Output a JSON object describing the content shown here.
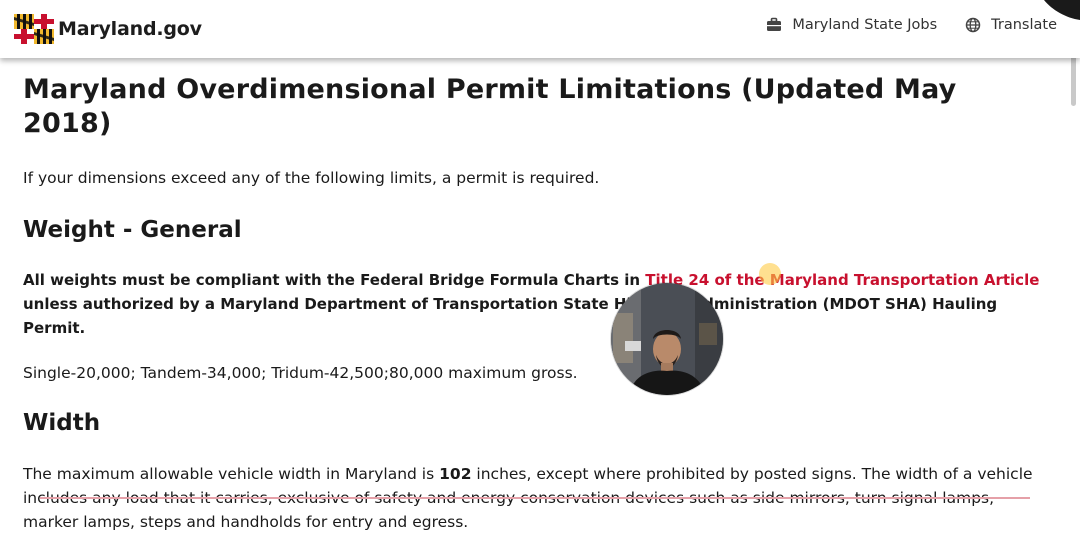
{
  "header": {
    "brand": "Maryland.gov",
    "nav": [
      {
        "label": "Maryland State Jobs",
        "icon": "briefcase-icon"
      },
      {
        "label": "Translate",
        "icon": "globe-icon"
      }
    ]
  },
  "page": {
    "title": "Maryland Overdimensional Permit Limitations (Updated May 2018)",
    "intro": "If your dimensions exceed any of the following limits, a permit is required.",
    "sections": {
      "weight": {
        "heading": "Weight - General",
        "rule_before": "All weights must be compliant with the Federal Bridge Formula Charts in ",
        "rule_link": "Title 24 of the Maryland Transportation Article",
        "rule_after": " unless authorized by a Maryland Department of Transportation State Highway Administration (MDOT SHA) Hauling Permit.",
        "limits": "Single-20,000; Tandem-34,000; Tridum-42,500;80,000 maximum gross."
      },
      "width": {
        "heading": "Width",
        "text_before": "The maximum allowable vehicle width in Maryland is ",
        "text_bold": "102",
        "text_after": " inches, except where prohibited by posted signs. The width of a vehicle includes any load that it carries, exclusive of safety and energy conservation devices such as side mirrors, turn signal lamps, marker lamps, steps and handholds for entry and egress."
      }
    }
  },
  "colors": {
    "link": "#c8102e",
    "flag_gold": "#f1b82d",
    "flag_red": "#c8102e",
    "cursor_highlight": "#ffcc46"
  }
}
